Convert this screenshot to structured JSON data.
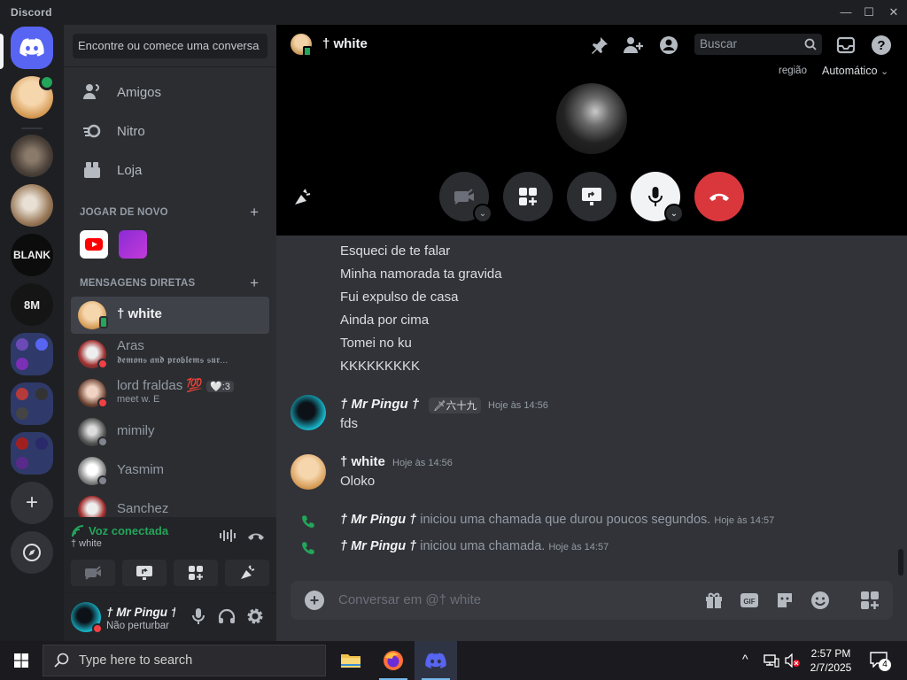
{
  "window": {
    "title": "Discord",
    "minimize": "—",
    "maximize": "☐",
    "close": "✕"
  },
  "dm_search": {
    "placeholder": "Encontre ou comece uma conversa"
  },
  "nav": [
    {
      "label": "Amigos",
      "icon": "friends-icon"
    },
    {
      "label": "Nitro",
      "icon": "nitro-icon"
    },
    {
      "label": "Loja",
      "icon": "shop-icon"
    }
  ],
  "sections": {
    "play_again": "JOGAR DE NOVO",
    "direct_messages": "MENSAGENS DIRETAS",
    "plus": "+"
  },
  "dms": [
    {
      "name": "† white",
      "sub": "",
      "status": "mobile",
      "active": true
    },
    {
      "name": "Aras",
      "sub": "𝖉𝖊𝖒𝖔𝖓𝖘 𝖆𝖓𝖉 𝖕𝖗𝖔𝖇𝖑𝖊𝖒𝖘 𝖘𝖚𝖗...",
      "status": "dnd"
    },
    {
      "name": "lord fraldas 💯",
      "tag": "🤍:3",
      "sub": "meet w. E",
      "status": "dnd"
    },
    {
      "name": "mimily",
      "sub": "",
      "status": "offline"
    },
    {
      "name": "Yasmim",
      "sub": "",
      "status": "offline"
    },
    {
      "name": "Sanchez",
      "sub": "",
      "status": "offline"
    }
  ],
  "voice": {
    "title": "Voz conectada",
    "channel": "† white"
  },
  "user": {
    "name": "† Mr Pingu †",
    "status": "Não perturbar"
  },
  "header": {
    "name": "† white",
    "search_placeholder": "Buscar",
    "region_label": "região",
    "region_value": "Automático"
  },
  "messages": {
    "lines": [
      "Esqueci de te falar",
      "Minha namorada ta gravida",
      "Fui expulso de casa",
      "Ainda por cima",
      "Tomei no ku",
      "KKKKKKKKK"
    ],
    "groups": [
      {
        "author": "† Mr Pingu †",
        "badge": "🗡六十九",
        "time": "Hoje às 14:56",
        "text": "fds"
      },
      {
        "author": "† white",
        "time": "Hoje às 14:56",
        "text": "Oloko"
      }
    ],
    "system": [
      {
        "author": "† Mr Pingu †",
        "text": " iniciou uma chamada que durou poucos segundos. ",
        "time": "Hoje às 14:57"
      },
      {
        "author": "† Mr Pingu †",
        "text": " iniciou uma chamada. ",
        "time": "Hoje às 14:57"
      }
    ]
  },
  "composer": {
    "placeholder": "Conversar em @† white"
  },
  "taskbar": {
    "search": "Type here to search",
    "time": "2:57 PM",
    "date": "2/7/2025",
    "notifications": "4"
  },
  "colors": {
    "brand": "#5865f2",
    "green": "#23a55a",
    "red": "#da373c",
    "dnd": "#f23f43"
  }
}
